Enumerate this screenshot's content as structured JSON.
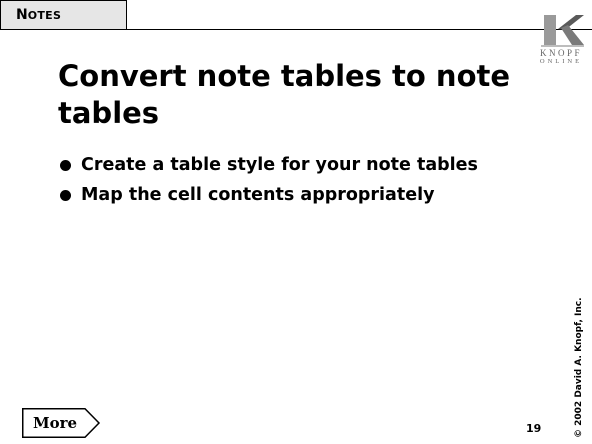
{
  "section_tab": {
    "first_letter": "N",
    "rest": "OTES"
  },
  "logo": {
    "line1": "KNOPF",
    "line2": "ONLINE"
  },
  "title": "Convert note tables to note tables",
  "bullets": [
    "Create a table style for your note tables",
    "Map the cell contents appropriately"
  ],
  "footer": {
    "more_label": "More",
    "page_number": "19",
    "copyright": "© 2002 David A. Knopf, Inc."
  }
}
